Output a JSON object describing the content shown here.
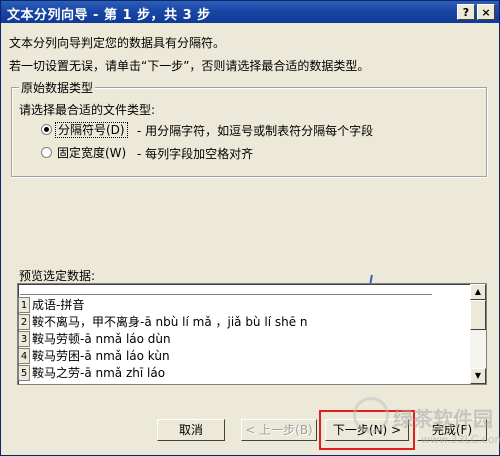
{
  "window": {
    "title": "文本分列向导 - 第 1 步，共 3 步",
    "help_label": "?",
    "close_label": "×"
  },
  "intro": {
    "line1": "文本分列向导判定您的数据具有分隔符。",
    "line2": "若一切设置无误，请单击“下一步”，否则请选择最合适的数据类型。"
  },
  "group": {
    "legend": "原始数据类型",
    "prompt": "请选择最合适的文件类型:",
    "options": [
      {
        "label": "分隔符号(D)",
        "desc": "- 用分隔字符，如逗号或制表符分隔每个字段",
        "checked": true
      },
      {
        "label": "固定宽度(W)",
        "desc": "- 每列字段加空格对齐",
        "checked": false
      }
    ]
  },
  "preview": {
    "label": "预览选定数据:",
    "rows": [
      {
        "num": "1",
        "text": "成语-拼音"
      },
      {
        "num": "2",
        "text": "鞍不离马，甲不离身-ā nbù lí mǎ ，jiǎ bù lí shē n"
      },
      {
        "num": "3",
        "text": "鞍马劳顿-ā nmǎ láo dùn"
      },
      {
        "num": "4",
        "text": "鞍马劳困-ā nmǎ láo kùn"
      },
      {
        "num": "5",
        "text": "鞍马之劳-ā nmǎ zhī láo"
      }
    ]
  },
  "buttons": {
    "cancel": "取消",
    "back": "< 上一步(B)",
    "next": "下一步(N) >",
    "finish": "完成(F)"
  },
  "watermark": {
    "text": "绿茶软件园",
    "url": "www.33LC.com"
  }
}
